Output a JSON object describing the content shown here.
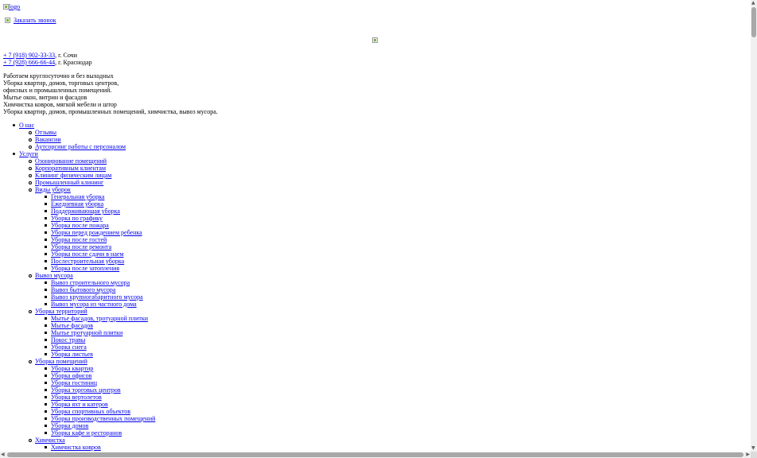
{
  "header": {
    "logo_alt": "logo",
    "callback_label": "Заказать звонок"
  },
  "contacts": {
    "phones": [
      {
        "number": "+ 7 (918) 902-33-33",
        "city": ", г. Сочи"
      },
      {
        "number": "+ 7 (928) 666-66-44",
        "city": ", г. Краснодар"
      }
    ]
  },
  "about": {
    "lines": [
      "Работаем круглосуточно и без выходных",
      "Уборка квартир, домов, торговых центров,",
      "офисных и промышленных помещений.",
      "Мытье окон, витрин и фасадов",
      "Химчистка ковров, мягкой мебели и штор",
      "Уборка квартир, домов, промышленных помещений, химчистка, вывоз мусора."
    ]
  },
  "menu": {
    "about_label": "О нас",
    "about_items": [
      "Отзывы",
      "Вакансии",
      "Аутсорсинг работы с персоналом"
    ],
    "services_label": "Услуги",
    "services_items": [
      "Озонирование помещений",
      "Корпоративным клиентам",
      "Клининг физическим лицам",
      "Промышленный клининг"
    ],
    "cleaning_types_label": "Виды уборок",
    "cleaning_types": [
      "Генеральная уборка",
      "Ежедневная уборка",
      "Поддерживающая уборка",
      "Уборка по графику",
      "Уборка после пожара",
      "Уборка перед рождением ребенка",
      "Уборка после гостей",
      "Уборка после ремонта",
      "Уборка после сдачи в наем",
      "Послестроительная уборка",
      "Уборка после затопления"
    ],
    "waste_label": "Вывоз мусора",
    "waste_items": [
      "Вывоз строительного мусора",
      "Вывоз бытового мусора",
      "Вывоз крупногабаритного мусора",
      "Вывоз мусора из частного дома"
    ],
    "territory_label": "Уборка территорий",
    "territory_items": [
      "Мытье фасадов, тротуарной плитки",
      "Мытье фасадов",
      "Мытье тротуарной плитки",
      "Покос травы",
      "Уборка снега",
      "Уборка листьев"
    ],
    "premises_label": "Уборка помещений",
    "premises_items": [
      "Уборка квартир",
      "Уборка офисов",
      "Уборка гостиниц",
      "Уборка торговых центров",
      "Уборка вертолетов",
      "Уборка яхт и катеров",
      "Уборка спортивных объектов",
      "Уборка производственных помещений",
      "Уборка домов",
      "Уборка кафе и ресторанов"
    ],
    "drycleaning_label": "Химчистка",
    "drycleaning_items": [
      "Химчистка ковров"
    ]
  },
  "colors": {
    "link": "#0000ee",
    "scrollbar_thumb": "#a8a8a8",
    "scrollbar_track": "#f0f0f0"
  }
}
